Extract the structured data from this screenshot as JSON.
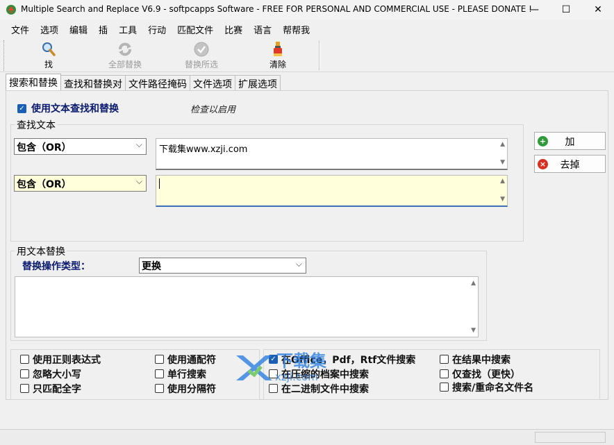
{
  "window": {
    "title": "Multiple Search and Replace V6.9 - softpcapps Software - FREE FOR PERSONAL AND COMMERCIAL USE - PLEASE DONATE !",
    "minimize": "—",
    "maximize": "☐",
    "close": "✕"
  },
  "menu": [
    "文件",
    "选项",
    "编辑",
    "插",
    "工具",
    "行动",
    "匹配文件",
    "比赛",
    "语言",
    "帮帮我"
  ],
  "toolbar": {
    "find": "找",
    "replace_all": "全部替换",
    "replace_selected": "替换所选",
    "clear": "清除"
  },
  "tabs": [
    "搜索和替换",
    "查找和替换对",
    "文件路径掩码",
    "文件选项",
    "扩展选项"
  ],
  "search": {
    "use_text_label": "使用文本查找和替换",
    "check_hint": "检查以启用",
    "group_title": "查找文本",
    "row1_mode": "包含（OR）",
    "row1_text": "下载集www.xzji.com",
    "row2_mode": "包含（OR）",
    "row2_text": ""
  },
  "side_buttons": {
    "add": "加",
    "remove": "去掉"
  },
  "replace": {
    "group_title": "用文本替换",
    "op_type_label": "替换操作类型：",
    "op_type_value": "更换",
    "text": ""
  },
  "options_left": [
    {
      "label": "使用正则表达式",
      "checked": false
    },
    {
      "label": "忽略大小写",
      "checked": false
    },
    {
      "label": "只匹配全字",
      "checked": false
    },
    {
      "label": "使用通配符",
      "checked": false
    },
    {
      "label": "单行搜索",
      "checked": false
    },
    {
      "label": "使用分隔符",
      "checked": false
    }
  ],
  "options_right": [
    {
      "label": "在Office，Pdf，Rtf文件搜索",
      "checked": true
    },
    {
      "label": "在压缩的档案中搜索",
      "checked": false
    },
    {
      "label": "在二进制文件中搜索",
      "checked": false
    },
    {
      "label": "在结果中搜索",
      "checked": false
    },
    {
      "label": "仅查找（更快）",
      "checked": false
    },
    {
      "label": "搜索/重命名文件名",
      "checked": false
    }
  ],
  "watermark": {
    "text1": "下载集",
    "text2": "xzji.com"
  },
  "colors": {
    "accent": "#1a5fb4",
    "input_highlight": "#ffffdc",
    "label_blue": "#0a1a6e"
  }
}
